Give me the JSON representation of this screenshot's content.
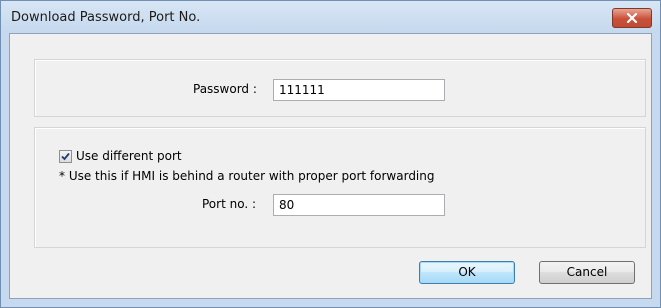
{
  "window": {
    "title": "Download Password, Port No."
  },
  "password_section": {
    "label": "Password :",
    "value": "111111"
  },
  "port_section": {
    "checkbox_label": "Use different port",
    "checkbox_checked": true,
    "note": "* Use this if HMI is behind a router with proper port forwarding",
    "port_label": "Port no. :",
    "port_value": "80"
  },
  "buttons": {
    "ok_label": "OK",
    "cancel_label": "Cancel"
  },
  "icons": {
    "close": "close-icon",
    "check": "checkmark-icon"
  },
  "colors": {
    "close_button": "#c9513a",
    "titlebar": "#c5d8ed",
    "client_bg": "#f0f0f0",
    "default_button_border": "#3c7fb1"
  }
}
